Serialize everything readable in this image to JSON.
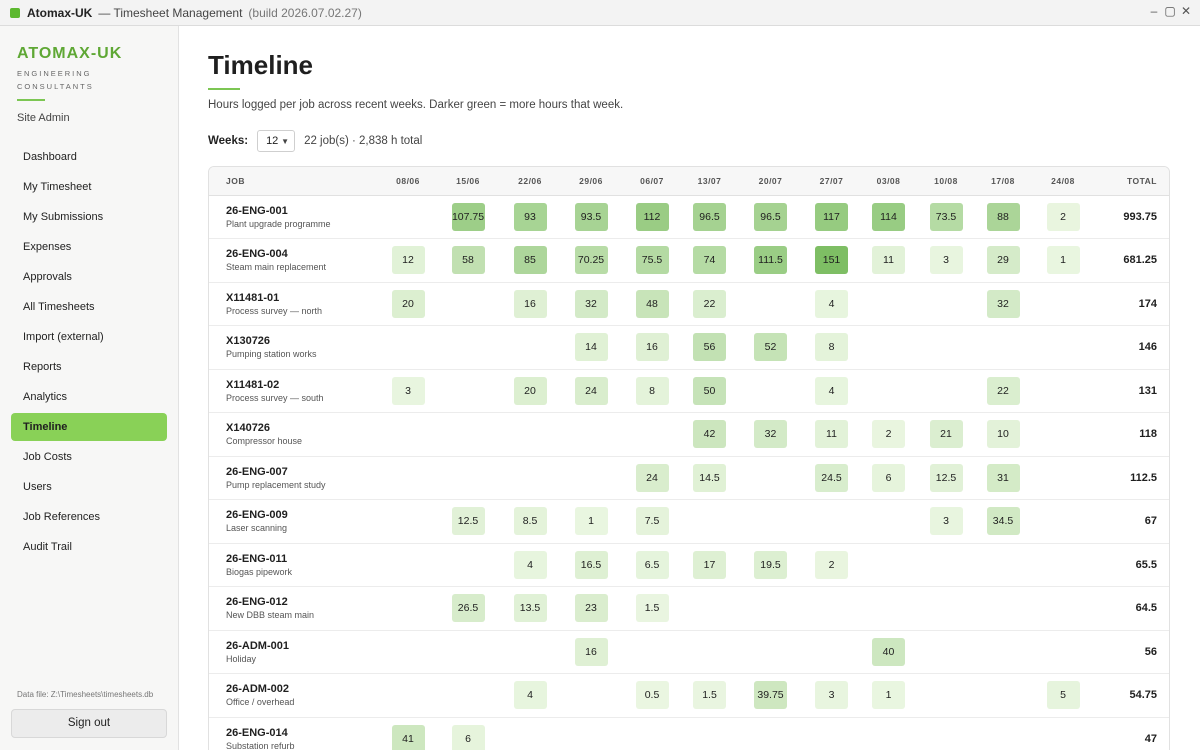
{
  "titlebar": {
    "app_name": "Atomax-UK",
    "subtitle": "— Timesheet Management",
    "build": "(build 2026.07.02.27)",
    "minimize": "–",
    "maximize": "▢",
    "close": "✕"
  },
  "sidebar": {
    "brand": "ATOMAX-UK",
    "brand_sub": "ENGINEERING CONSULTANTS",
    "role": "Site Admin",
    "items": [
      {
        "label": "Dashboard",
        "active": false
      },
      {
        "label": "My Timesheet",
        "active": false
      },
      {
        "label": "My Submissions",
        "active": false
      },
      {
        "label": "Expenses",
        "active": false
      },
      {
        "label": "Approvals",
        "active": false
      },
      {
        "label": "All Timesheets",
        "active": false
      },
      {
        "label": "Import (external)",
        "active": false
      },
      {
        "label": "Reports",
        "active": false
      },
      {
        "label": "Analytics",
        "active": false
      },
      {
        "label": "Timeline",
        "active": true
      },
      {
        "label": "Job Costs",
        "active": false
      },
      {
        "label": "Users",
        "active": false
      },
      {
        "label": "Job References",
        "active": false
      },
      {
        "label": "Audit Trail",
        "active": false
      }
    ],
    "data_file": "Data file: Z:\\Timesheets\\timesheets.db",
    "sign_out": "Sign out"
  },
  "main": {
    "title": "Timeline",
    "subtitle": "Hours logged per job across recent weeks. Darker green = more hours that week.",
    "weeks_label": "Weeks:",
    "weeks_value": "12",
    "summary": "22 job(s) · 2,838 h total"
  },
  "colors": {
    "accent": "#89d157",
    "brand": "#5fa835",
    "cell_light": "#eaf6e1",
    "cell_dark": "#86c36a"
  },
  "table": {
    "headers": {
      "job": "JOB",
      "weeks": [
        "08/06",
        "15/06",
        "22/06",
        "29/06",
        "06/07",
        "13/07",
        "20/07",
        "27/07",
        "03/08",
        "10/08",
        "17/08",
        "24/08"
      ],
      "total": "TOTAL"
    },
    "rows": [
      {
        "code": "26-ENG-001",
        "desc": "Plant upgrade programme",
        "hours": [
          "",
          "107.75",
          "93",
          "93.5",
          "112",
          "96.5",
          "96.5",
          "117",
          "114",
          "73.5",
          "88",
          "2"
        ],
        "total": "993.75"
      },
      {
        "code": "26-ENG-004",
        "desc": "Steam main replacement",
        "hours": [
          "12",
          "58",
          "85",
          "70.25",
          "75.5",
          "74",
          "111.5",
          "151",
          "11",
          "3",
          "29",
          "1"
        ],
        "total": "681.25"
      },
      {
        "code": "X11481-01",
        "desc": "Process survey — north",
        "hours": [
          "20",
          "",
          "16",
          "32",
          "48",
          "22",
          "",
          "4",
          "",
          "",
          "32",
          ""
        ],
        "total": "174"
      },
      {
        "code": "X130726",
        "desc": "Pumping station works",
        "hours": [
          "",
          "",
          "",
          "14",
          "16",
          "56",
          "52",
          "8",
          "",
          "",
          "",
          ""
        ],
        "total": "146"
      },
      {
        "code": "X11481-02",
        "desc": "Process survey — south",
        "hours": [
          "3",
          "",
          "20",
          "24",
          "8",
          "50",
          "",
          "4",
          "",
          "",
          "22",
          ""
        ],
        "total": "131"
      },
      {
        "code": "X140726",
        "desc": "Compressor house",
        "hours": [
          "",
          "",
          "",
          "",
          "",
          "42",
          "32",
          "11",
          "2",
          "21",
          "10",
          ""
        ],
        "total": "118"
      },
      {
        "code": "26-ENG-007",
        "desc": "Pump replacement study",
        "hours": [
          "",
          "",
          "",
          "",
          "24",
          "14.5",
          "",
          "24.5",
          "6",
          "12.5",
          "31",
          ""
        ],
        "total": "112.5"
      },
      {
        "code": "26-ENG-009",
        "desc": "Laser scanning",
        "hours": [
          "",
          "12.5",
          "8.5",
          "1",
          "7.5",
          "",
          "",
          "",
          "",
          "3",
          "34.5",
          ""
        ],
        "total": "67"
      },
      {
        "code": "26-ENG-011",
        "desc": "Biogas pipework",
        "hours": [
          "",
          "",
          "4",
          "16.5",
          "6.5",
          "17",
          "19.5",
          "2",
          "",
          "",
          "",
          ""
        ],
        "total": "65.5"
      },
      {
        "code": "26-ENG-012",
        "desc": "New DBB steam main",
        "hours": [
          "",
          "26.5",
          "13.5",
          "23",
          "1.5",
          "",
          "",
          "",
          "",
          "",
          "",
          ""
        ],
        "total": "64.5"
      },
      {
        "code": "26-ADM-001",
        "desc": "Holiday",
        "hours": [
          "",
          "",
          "",
          "16",
          "",
          "",
          "",
          "",
          "40",
          "",
          "",
          ""
        ],
        "total": "56"
      },
      {
        "code": "26-ADM-002",
        "desc": "Office / overhead",
        "hours": [
          "",
          "",
          "4",
          "",
          "0.5",
          "1.5",
          "39.75",
          "3",
          "1",
          "",
          "",
          "5"
        ],
        "total": "54.75"
      },
      {
        "code": "26-ENG-014",
        "desc": "Substation refurb",
        "hours": [
          "41",
          "6",
          "",
          "",
          "",
          "",
          "",
          "",
          "",
          "",
          "",
          ""
        ],
        "total": "47"
      }
    ]
  }
}
